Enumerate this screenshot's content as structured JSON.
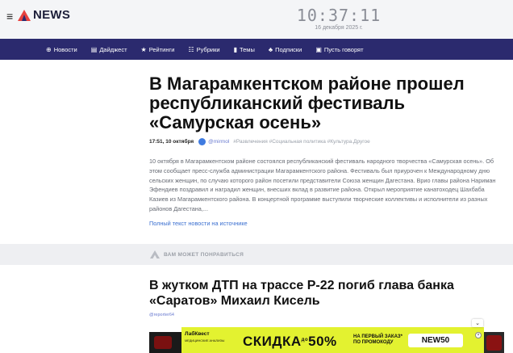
{
  "header": {
    "logo_text": "NEWS",
    "menu_icon": "hamburger-icon",
    "logo_icon": "logo-triangle-icon",
    "time": "10:37:11",
    "date": "16 декабря 2025 г."
  },
  "nav": {
    "items": [
      {
        "icon": "globe-icon",
        "glyph": "⊕",
        "label": "Новости"
      },
      {
        "icon": "newspaper-icon",
        "glyph": "▤",
        "label": "Дайджест"
      },
      {
        "icon": "star-icon",
        "glyph": "★",
        "label": "Рейтинги"
      },
      {
        "icon": "grid-icon",
        "glyph": "☷",
        "label": "Рубрики"
      },
      {
        "icon": "bookmark-icon",
        "glyph": "▮",
        "label": "Темы"
      },
      {
        "icon": "users-icon",
        "glyph": "♣",
        "label": "Подписки"
      },
      {
        "icon": "chat-icon",
        "glyph": "▣",
        "label": "Пусть говорят"
      }
    ]
  },
  "article": {
    "title": "В Магарамкентском районе прошел республиканский фестиваль «Самурская осень»",
    "date": "17:51, 10 октября",
    "author": "@mirmol",
    "tags": "#Развлечения #Социальная политика #Культура.Другое",
    "lead": "10 октября в Магарамкентском районе состоялся республиканский фестиваль народного творчества «Самурская осень». Об этом сообщает пресс-служба администрации Магарамкентского района. Фестиваль был приурочен к Международному дню сельских женщин, по случаю которого район посетили представители Союза женщин Дагестана. Врио главы района Нариман Эфендиев поздравил и наградил женщин, внесших вклад в развитие района. Открыл мероприятие канатоходец Шахбаба Казиев из Магарамкентского района. В концертной программе выступили творческие коллективы и исполнители из разных районов Дагестана,...",
    "source_link": "Полный текст новости на источнике"
  },
  "recommendations": {
    "title": "ВАМ МОЖЕТ ПОНРАВИТЬСЯ",
    "items": [
      {
        "title": "В жутком ДТП на трассе Р-22 погиб глава банка «Саратов» Михаил Кисель",
        "author": "@reporter64"
      }
    ]
  },
  "ad": {
    "brand": "ЛабКвест",
    "brand_sub": "МЕДИЦИНСКИЕ АНАЛИЗЫ",
    "headline_a": "СКИДКА",
    "headline_small": "до",
    "headline_b": "50%",
    "side_text_1": "НА ПЕРВЫЙ ЗАКАЗ*",
    "side_text_2": "ПО ПРОМОКОДУ",
    "promo_code": "NEW50",
    "close_glyph": "×",
    "collapse_glyph": "⌄",
    "colors": {
      "background": "#e3f230"
    }
  },
  "colors": {
    "nav_bg": "#2b2a6e",
    "logo_accent": "#e8423f",
    "link": "#3a6fd0"
  }
}
